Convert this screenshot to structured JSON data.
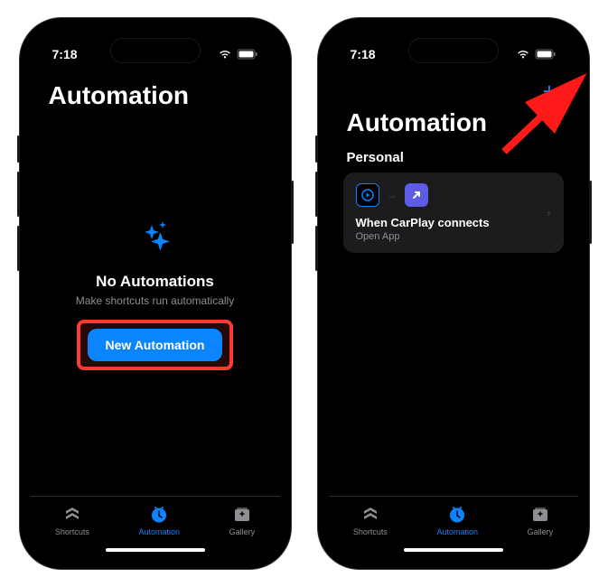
{
  "status": {
    "time": "7:18"
  },
  "left": {
    "title": "Automation",
    "empty": {
      "heading": "No Automations",
      "subtext": "Make shortcuts run automatically",
      "button": "New Automation"
    }
  },
  "right": {
    "title": "Automation",
    "section": "Personal",
    "automation": {
      "title": "When CarPlay connects",
      "action": "Open App"
    }
  },
  "tabs": {
    "shortcuts": "Shortcuts",
    "automation": "Automation",
    "gallery": "Gallery"
  }
}
